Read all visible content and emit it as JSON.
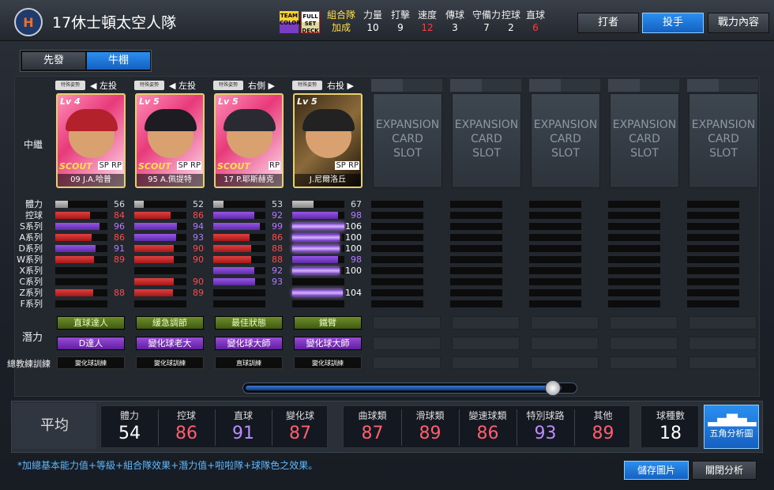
{
  "header": {
    "team_name": "17休士頓太空人隊",
    "team_logo": "H",
    "badge_team": "TEAM COLOR",
    "badge_full": "FULL SET DECK",
    "combo_label": "組合隊",
    "combo_value": "加成",
    "stats": [
      {
        "label": "力量",
        "value": "10",
        "red": false
      },
      {
        "label": "打擊",
        "value": "9",
        "red": false
      },
      {
        "label": "速度",
        "value": "12",
        "red": true
      },
      {
        "label": "傳球",
        "value": "3",
        "red": false
      },
      {
        "label": "守備力",
        "value": "7",
        "red": false
      },
      {
        "label": "控球",
        "value": "2",
        "red": false
      },
      {
        "label": "直球",
        "value": "6",
        "red": true
      }
    ],
    "buttons": {
      "batter": "打者",
      "pitcher": "投手",
      "power": "戰力內容"
    }
  },
  "tabs": {
    "starter": "先發",
    "bullpen": "牛棚"
  },
  "row_labels": {
    "role": "中繼",
    "stats": [
      "體力",
      "控球",
      "S系列",
      "A系列",
      "D系列",
      "W系列",
      "X系列",
      "C系列",
      "Z系列",
      "F系列"
    ],
    "potential": "潛力",
    "training": "總教練訓練"
  },
  "special_tag": "特殊姿勢",
  "expansion_text": [
    "EXPANSION",
    "CARD",
    "SLOT"
  ],
  "cards": [
    {
      "pos": "◀ 左投",
      "lv": "Lv 4",
      "scout": "SCOUT",
      "sp": "SP RP",
      "name": "09 J.A.哈普",
      "cap": "#b3212a",
      "bg": "linear-gradient(135deg,#ff8fb8,#e83a7a 40%,#ffe1f0)",
      "stats": [
        [
          "gray",
          56,
          "56"
        ],
        [
          "red",
          84,
          "84"
        ],
        [
          "pur",
          96,
          "96"
        ],
        [
          "red",
          86,
          "86"
        ],
        [
          "pur",
          91,
          "91"
        ],
        [
          "red",
          89,
          "89"
        ],
        null,
        null,
        [
          "red",
          88,
          "88"
        ],
        null
      ],
      "p1": "直球達人",
      "p1c": "green",
      "p2": "D達人",
      "p2c": "purple",
      "train": "變化球訓練"
    },
    {
      "pos": "◀ 左投",
      "lv": "Lv 5",
      "scout": "SCOUT",
      "sp": "SP RP",
      "name": "95 A.佩提特",
      "cap": "#1c1c22",
      "bg": "linear-gradient(135deg,#ff8fb8,#e83a7a 40%,#ffe1f0)",
      "stats": [
        [
          "gray",
          52,
          "52"
        ],
        [
          "red",
          86,
          "86"
        ],
        [
          "pur",
          94,
          "94"
        ],
        [
          "pur",
          93,
          "93"
        ],
        [
          "red",
          90,
          "90"
        ],
        [
          "red",
          90,
          "90"
        ],
        null,
        [
          "red",
          90,
          "90"
        ],
        [
          "red",
          89,
          "89"
        ],
        null
      ],
      "p1": "緩急調節",
      "p1c": "green",
      "p2": "變化球老大",
      "p2c": "purple",
      "train": "變化球訓練"
    },
    {
      "pos": "右側 ▶",
      "lv": "Lv 5",
      "scout": "SCOUT",
      "sp": "RP",
      "name": "17 P.耶斯赫克",
      "cap": "#2a2a33",
      "bg": "linear-gradient(135deg,#ff8fb8,#e83a7a 40%,#ffe1f0)",
      "stats": [
        [
          "gray",
          53,
          "53"
        ],
        [
          "pur",
          92,
          "92"
        ],
        [
          "pur",
          99,
          "99"
        ],
        [
          "red",
          86,
          "86"
        ],
        [
          "red",
          88,
          "88"
        ],
        [
          "red",
          88,
          "88"
        ],
        [
          "pur",
          92,
          "92"
        ],
        [
          "pur",
          93,
          "93"
        ],
        null,
        null
      ],
      "p1": "最佳狀態",
      "p1c": "green",
      "p2": "變化球大師",
      "p2c": "purple",
      "train": "直球訓練"
    },
    {
      "pos": "右投 ▶",
      "lv": "Lv 5",
      "scout": "",
      "sp": "SP RP",
      "name": "J.尼爾洛丘",
      "cap": "#222",
      "bg": "linear-gradient(135deg,#3a2a18,#8a6a3a 50%,#1a120a)",
      "stats": [
        [
          "gray",
          67,
          "67"
        ],
        [
          "pur",
          98,
          "98"
        ],
        [
          "glow",
          106,
          "106"
        ],
        [
          "glow",
          100,
          "100"
        ],
        [
          "glow",
          100,
          "100"
        ],
        [
          "pur",
          98,
          "98"
        ],
        [
          "glow",
          100,
          "100"
        ],
        null,
        [
          "glow",
          104,
          "104"
        ],
        null
      ],
      "p1": "鐵臂",
      "p1c": "green",
      "p2": "變化球大師",
      "p2c": "purple",
      "train": "變化球訓練"
    }
  ],
  "averages": {
    "label": "平均",
    "group1": [
      {
        "label": "體力",
        "value": "54",
        "color": "w"
      },
      {
        "label": "控球",
        "value": "86",
        "color": "r"
      },
      {
        "label": "直球",
        "value": "91",
        "color": "p"
      },
      {
        "label": "變化球",
        "value": "87",
        "color": "r"
      }
    ],
    "group2": [
      {
        "label": "曲球類",
        "value": "87",
        "color": "r"
      },
      {
        "label": "滑球類",
        "value": "89",
        "color": "r"
      },
      {
        "label": "變速球類",
        "value": "86",
        "color": "r"
      },
      {
        "label": "特別球路",
        "value": "93",
        "color": "p"
      },
      {
        "label": "其他",
        "value": "89",
        "color": "r"
      }
    ],
    "pitch_count": {
      "label": "球種數",
      "value": "18"
    },
    "analyze": "五角分析圖"
  },
  "note": "*加總基本能力值+等級+組合隊效果+潛力值+啦啦隊+球隊色之效果。",
  "footer": {
    "save": "儲存圖片",
    "close": "關閉分析"
  },
  "slider": {
    "value": 0.95
  }
}
